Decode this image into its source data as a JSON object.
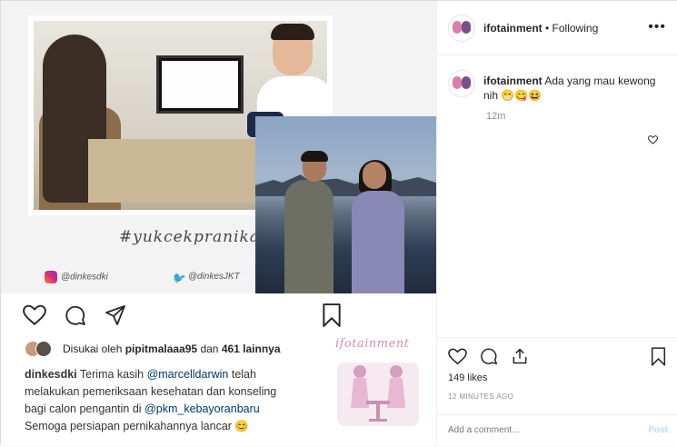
{
  "post": {
    "media": {
      "hashtag": "#yukcekpranikah",
      "instagram_handle": "@dinkesdki",
      "twitter_handle": "@dinkesJKT"
    },
    "liked_by": {
      "prefix": "Disukai oleh",
      "user": "pipitmalaaa95",
      "connector": "dan",
      "others": "461 lainnya"
    },
    "caption": {
      "user": "dinkesdki",
      "text_1": "Terima kasih",
      "mention_1": "@marcelldarwin",
      "text_2": "telah melakukan pemeriksaan kesehatan dan konseling bagi calon pengantin di",
      "mention_2": "@pkm_kebayoranbaru",
      "text_3": "Semoga persiapan pernikahannya lancar 😊"
    },
    "watermark": "ifotainment"
  },
  "header": {
    "username": "ifotainment",
    "separator": " • ",
    "follow_status": "Following",
    "more_icon": "more-dots-icon"
  },
  "comment": {
    "username": "ifotainment",
    "text": "Ada yang mau kewong nih 😁😋😆",
    "time": "12m"
  },
  "stats": {
    "likes": "149 likes",
    "time_ago": "12 MINUTES AGO"
  },
  "add_comment": {
    "placeholder": "Add a comment...",
    "post_label": "Post"
  },
  "colors": {
    "border": "#dbdbdb",
    "muted": "#8e8e8e",
    "link": "#00376b",
    "post_disabled": "#b2dffc"
  }
}
